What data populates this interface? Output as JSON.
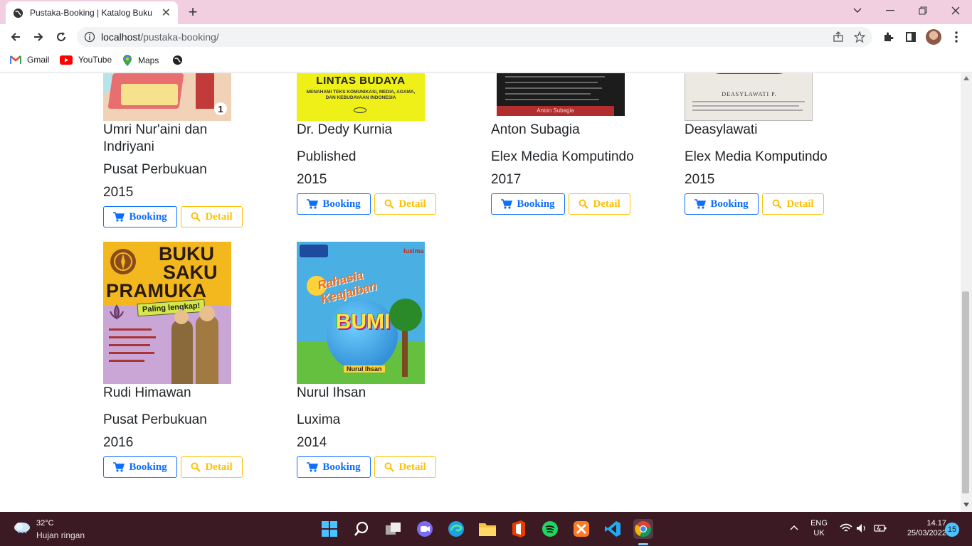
{
  "browser": {
    "tab_title": "Pustaka-Booking | Katalog Buku",
    "url_host": "localhost",
    "url_path": "/pustaka-booking/",
    "bookmarks": [
      "Gmail",
      "YouTube",
      "Maps"
    ]
  },
  "books_row1": [
    {
      "author_line1": "Umri Nur'aini dan",
      "author_line2": "Indriyani",
      "publisher": "Pusat Perbukuan",
      "year": "2015",
      "book_label": "Booking",
      "detail_label": "Detail"
    },
    {
      "author_line1": "Dr. Dedy Kurnia",
      "author_line2": "",
      "publisher": "Published",
      "year": "2015",
      "book_label": "Booking",
      "detail_label": "Detail"
    },
    {
      "author_line1": "Anton Subagia",
      "author_line2": "",
      "publisher": "Elex Media Komputindo",
      "year": "2017",
      "book_label": "Booking",
      "detail_label": "Detail"
    },
    {
      "author_line1": "Deasylawati",
      "author_line2": "",
      "publisher": "Elex Media Komputindo",
      "year": "2015",
      "book_label": "Booking",
      "detail_label": "Detail"
    }
  ],
  "books_row2": [
    {
      "author": "Rudi Himawan",
      "publisher": "Pusat Perbukuan",
      "year": "2016",
      "book_label": "Booking",
      "detail_label": "Detail"
    },
    {
      "author": "Nurul Ihsan",
      "publisher": "Luxima",
      "year": "2014",
      "book_label": "Booking",
      "detail_label": "Detail"
    }
  ],
  "covers": {
    "c2_title": "LINTAS BUDAYA",
    "c2_sub": "MENAHAMI TEKS KOMUNIKASI, MEDIA, AGAMA, DAN KEBUDAYAAN INDONESIA",
    "c3_author": "Anton Subagia",
    "c4_author": "DEASYLAWATI P.",
    "c5_title1": "BUKU",
    "c5_title2": "SAKU",
    "c5_title3": "PRAMUKA",
    "c5_badge": "Paling lengkap!",
    "c6_title": "Rahasia Keajaiban",
    "c6_big": "BUMI",
    "c6_author": "Nurul Ihsan",
    "c6_brand": "luxima"
  },
  "taskbar": {
    "temp": "32°C",
    "weather": "Hujan ringan",
    "lang1": "ENG",
    "lang2": "UK",
    "time": "14.17",
    "date": "25/03/2022",
    "notif": "15"
  },
  "colors": {
    "primary": "#0d6efd",
    "warning": "#ffc107",
    "tabbar": "#f2cfe0",
    "taskbar": "#3b1a24"
  }
}
